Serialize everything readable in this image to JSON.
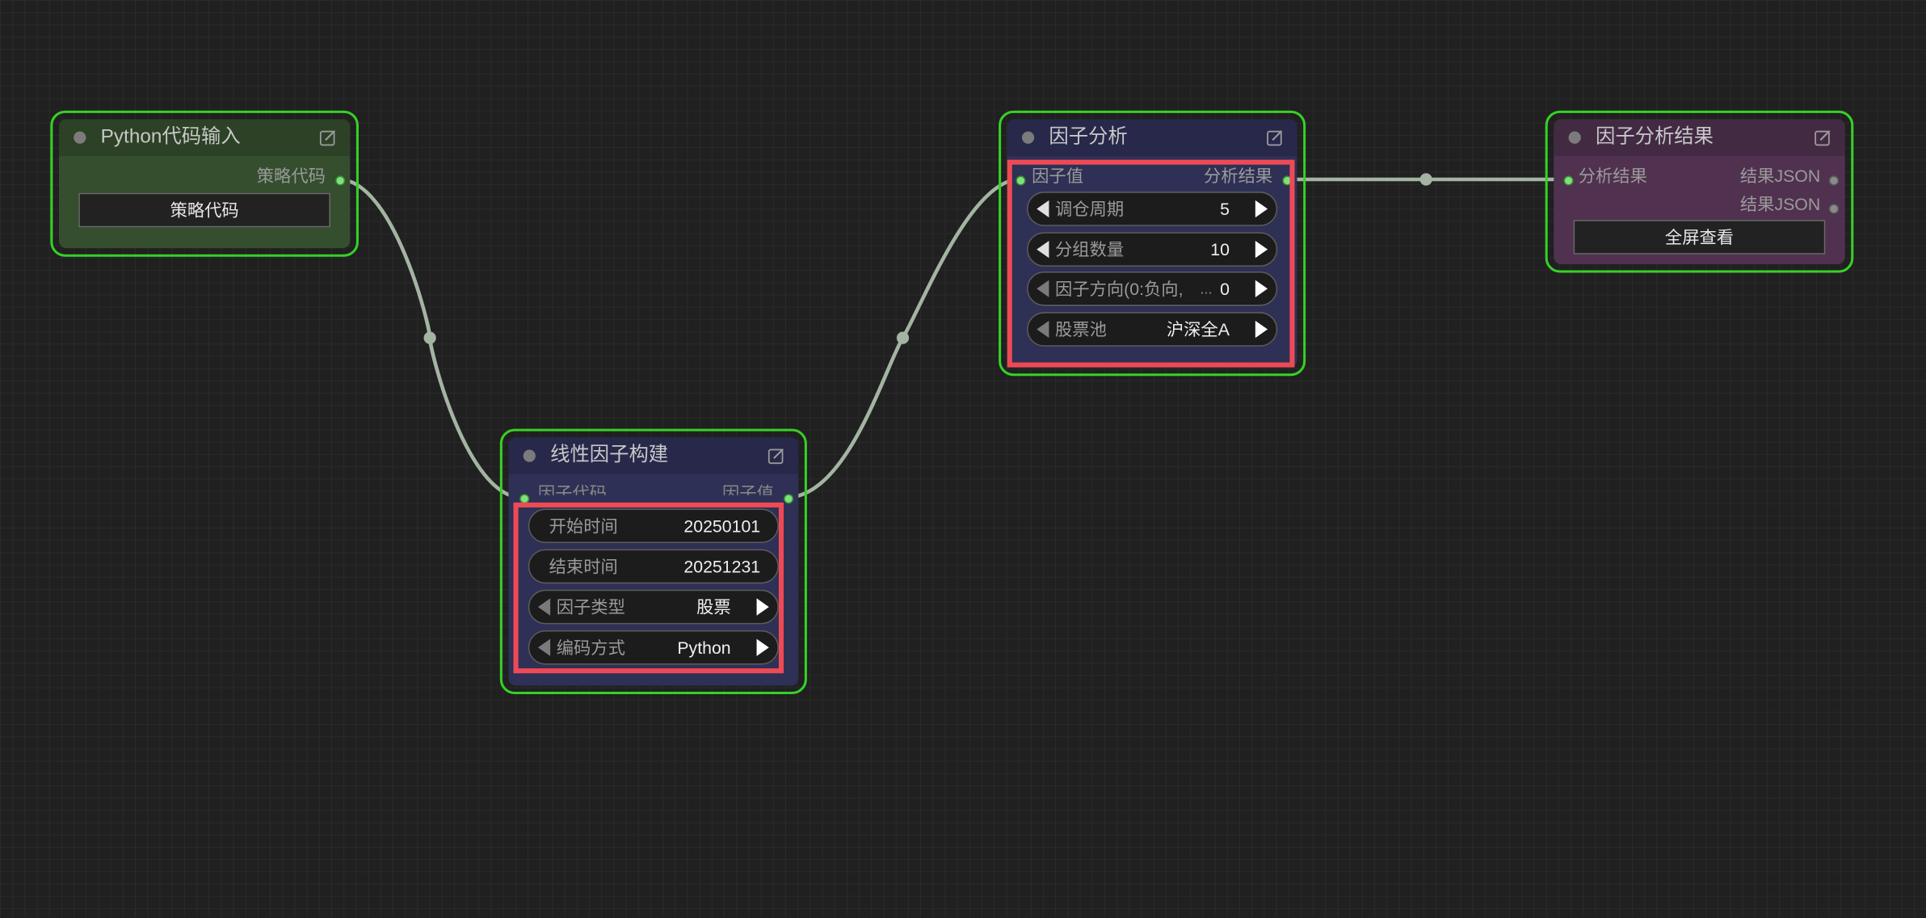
{
  "colors": {
    "canvas_bg": "#202020",
    "node_outline": "#36d126",
    "highlight_box": "#ee4a55",
    "link": "#a4b4a2",
    "port_active": "#7ee07a"
  },
  "nodes": {
    "python_input": {
      "title": "Python代码输入",
      "output_label": "策略代码",
      "button_label": "策略代码"
    },
    "linear_factor": {
      "title": "线性因子构建",
      "input_label": "因子代码",
      "output_label": "因子值",
      "widgets": [
        {
          "label": "开始时间",
          "value": "20250101"
        },
        {
          "label": "结束时间",
          "value": "20251231"
        },
        {
          "label": "因子类型",
          "value": "股票"
        },
        {
          "label": "编码方式",
          "value": "Python"
        }
      ]
    },
    "factor_analysis": {
      "title": "因子分析",
      "input_label": "因子值",
      "output_label": "分析结果",
      "widgets": [
        {
          "label": "调仓周期",
          "value": "5"
        },
        {
          "label": "分组数量",
          "value": "10"
        },
        {
          "label": "因子方向(0:负向,",
          "value": "0",
          "ellipsis": "..."
        },
        {
          "label": "股票池",
          "value": "沪深全A"
        }
      ]
    },
    "factor_result": {
      "title": "因子分析结果",
      "input_label": "分析结果",
      "output_labels": [
        "结果JSON",
        "结果JSON"
      ],
      "button_label": "全屏查看"
    }
  },
  "icons": {
    "edit": "edit-icon",
    "arrow_left": "arrow-left-icon",
    "arrow_right": "arrow-right-icon"
  }
}
